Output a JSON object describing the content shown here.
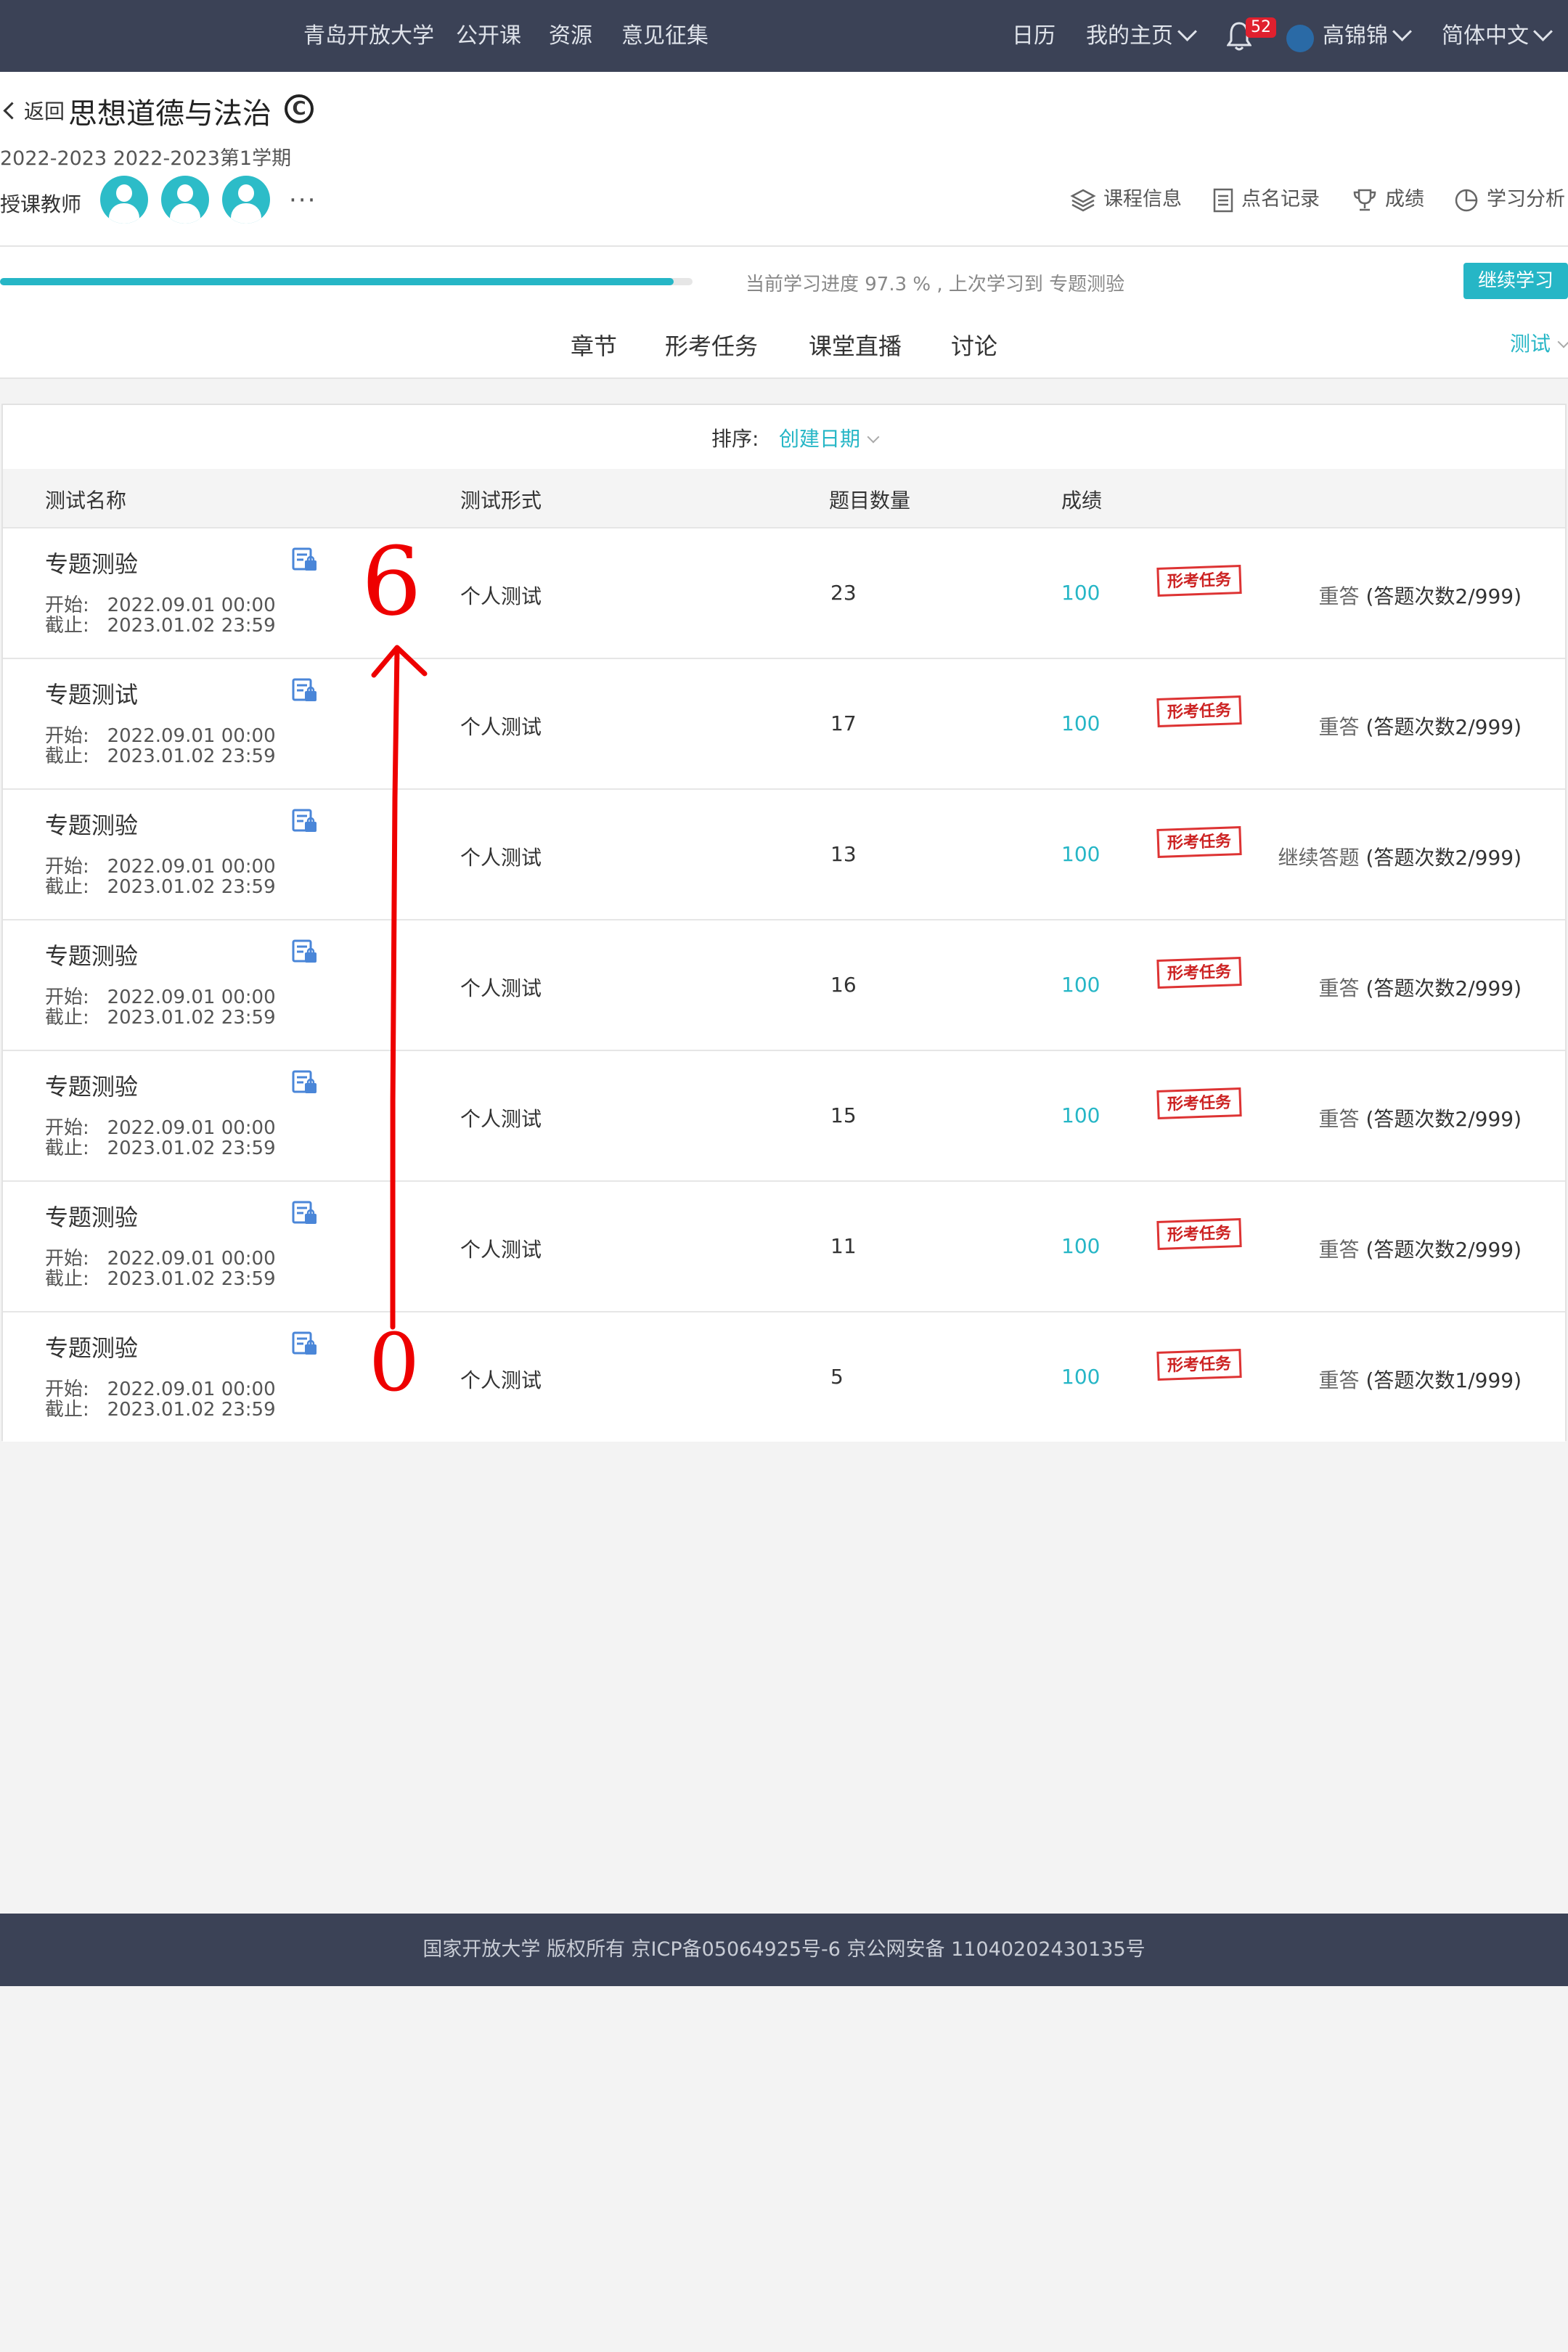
{
  "topbar": {
    "left_links": [
      "青岛开放大学",
      "公开课",
      "资源",
      "意见征集"
    ],
    "calendar": "日历",
    "my_home": "我的主页",
    "notification_count": "52",
    "username": "高锦锦",
    "language": "简体中文"
  },
  "course": {
    "back_label": "返回",
    "title": "思想道德与法治",
    "term": "2022-2023 2022-2023第1学期",
    "teacher_label": "授课教师",
    "more": "···"
  },
  "tools": [
    {
      "label": "课程信息",
      "icon": "layers-icon"
    },
    {
      "label": "点名记录",
      "icon": "document-icon"
    },
    {
      "label": "成绩",
      "icon": "trophy-icon"
    },
    {
      "label": "学习分析",
      "icon": "pie-chart-icon"
    }
  ],
  "progress": {
    "percent": 97.3,
    "text": "当前学习进度 97.3 % , 上次学习到 专题测验",
    "continue_label": "继续学习"
  },
  "tabs": [
    "章节",
    "形考任务",
    "课堂直播",
    "讨论"
  ],
  "test_filter": "测试",
  "sort": {
    "label": "排序:",
    "value": "创建日期"
  },
  "table": {
    "headers": [
      "测试名称",
      "测试形式",
      "题目数量",
      "成绩"
    ],
    "start_label": "开始:",
    "end_label": "截止:",
    "stamp_label": "形考任务",
    "rows": [
      {
        "name": "专题测验",
        "start": "2022.09.01 00:00",
        "end": "2023.01.02 23:59",
        "type": "个人测试",
        "count": "23",
        "score": "100",
        "action": "重答",
        "attempts": "(答题次数2/999)"
      },
      {
        "name": "专题测试",
        "start": "2022.09.01 00:00",
        "end": "2023.01.02 23:59",
        "type": "个人测试",
        "count": "17",
        "score": "100",
        "action": "重答",
        "attempts": "(答题次数2/999)"
      },
      {
        "name": "专题测验",
        "start": "2022.09.01 00:00",
        "end": "2023.01.02 23:59",
        "type": "个人测试",
        "count": "13",
        "score": "100",
        "action": "继续答题",
        "attempts": "(答题次数2/999)"
      },
      {
        "name": "专题测验",
        "start": "2022.09.01 00:00",
        "end": "2023.01.02 23:59",
        "type": "个人测试",
        "count": "16",
        "score": "100",
        "action": "重答",
        "attempts": "(答题次数2/999)"
      },
      {
        "name": "专题测验",
        "start": "2022.09.01 00:00",
        "end": "2023.01.02 23:59",
        "type": "个人测试",
        "count": "15",
        "score": "100",
        "action": "重答",
        "attempts": "(答题次数2/999)"
      },
      {
        "name": "专题测验",
        "start": "2022.09.01 00:00",
        "end": "2023.01.02 23:59",
        "type": "个人测试",
        "count": "11",
        "score": "100",
        "action": "重答",
        "attempts": "(答题次数2/999)"
      },
      {
        "name": "专题测验",
        "start": "2022.09.01 00:00",
        "end": "2023.01.02 23:59",
        "type": "个人测试",
        "count": "5",
        "score": "100",
        "action": "重答",
        "attempts": "(答题次数1/999)"
      }
    ]
  },
  "annotation": {
    "top_label": "6",
    "bottom_label": "0",
    "color": "#ee0000"
  },
  "footer": {
    "text": "国家开放大学 版权所有 京ICP备05064925号-6 京公网安备 11040202430135号"
  },
  "colors": {
    "accent": "#26b6c6",
    "nav_bg": "#3b4256",
    "badge": "#e0202e",
    "stamp": "#cc2222"
  }
}
